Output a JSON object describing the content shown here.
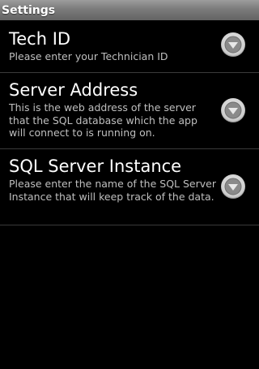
{
  "window": {
    "title": "Settings"
  },
  "preferences": [
    {
      "title": "Tech ID",
      "summary": "Please enter your Technician ID",
      "icon": "chevron-down-icon"
    },
    {
      "title": "Server Address",
      "summary": "This is the web address of the server that the SQL database which the app will connect to is running on.",
      "icon": "chevron-down-icon"
    },
    {
      "title": "SQL Server Instance",
      "summary": "Please enter the name of the SQL Server Instance that will keep track of the data.",
      "icon": "chevron-down-icon"
    }
  ],
  "colors": {
    "background": "#000000",
    "title_bar": "#7b7b7b",
    "summary_text": "#bfbfbf",
    "divider": "#3a3a3a"
  }
}
